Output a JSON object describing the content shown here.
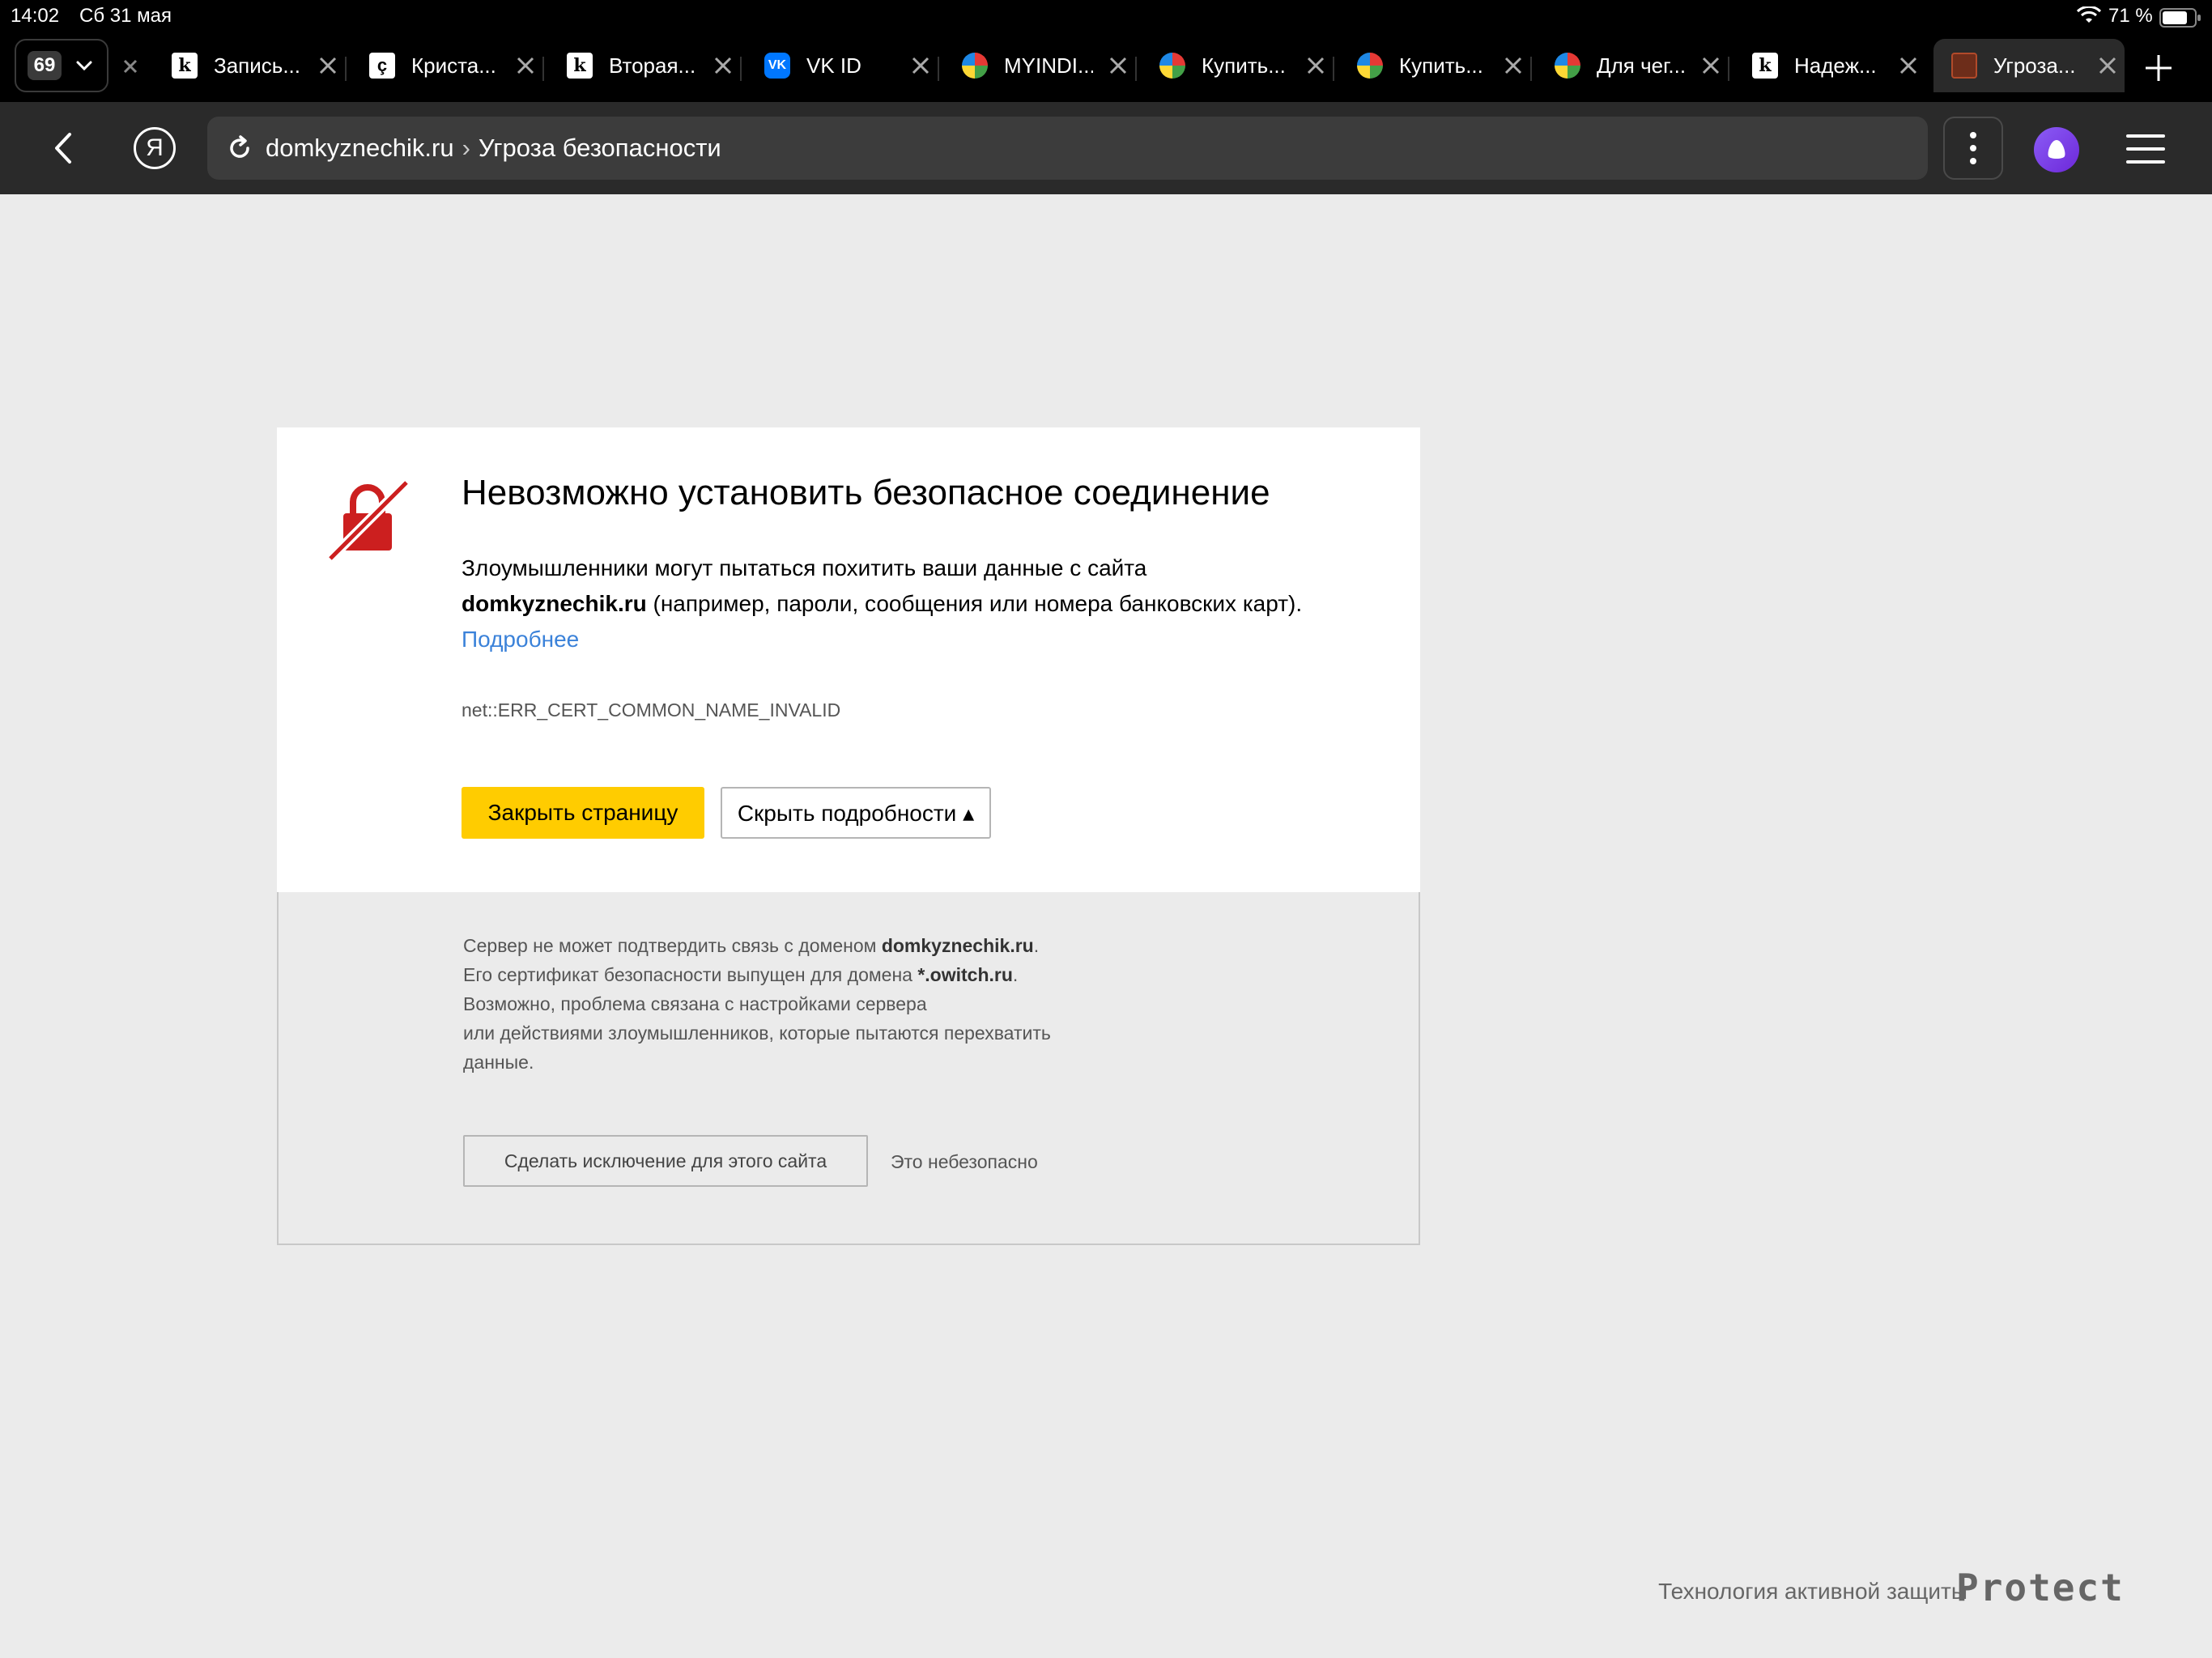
{
  "status_bar": {
    "time": "14:02",
    "date": "Сб 31 мая",
    "battery_percent": "71 %"
  },
  "tab_bar": {
    "tab_count": "69",
    "tabs": [
      {
        "label": "Запись...",
        "favicon": "k-icon"
      },
      {
        "label": "Криста...",
        "favicon": "c-icon"
      },
      {
        "label": "Вторая...",
        "favicon": "k-icon"
      },
      {
        "label": "VK ID",
        "favicon": "vk-icon",
        "favicon_text": "VK"
      },
      {
        "label": "MYINDI...",
        "favicon": "ball-icon"
      },
      {
        "label": "Купить...",
        "favicon": "ball-icon"
      },
      {
        "label": "Купить...",
        "favicon": "ball-icon"
      },
      {
        "label": "Для чег...",
        "favicon": "ball-icon"
      },
      {
        "label": "Надеж...",
        "favicon": "k-icon"
      },
      {
        "label": "Угроза...",
        "favicon": "red-icon",
        "active": true
      }
    ]
  },
  "toolbar": {
    "ya_letter": "Я",
    "url_host": "domkyznechik.ru",
    "url_separator": "›",
    "url_title": "Угроза безопасности"
  },
  "error": {
    "title": "Невозможно установить безопасное соединение",
    "desc_prefix": "Злоумышленники могут пытаться похитить ваши данные с сайта",
    "desc_domain": "domkyznechik.ru",
    "desc_suffix": " (например, пароли, сообщения или номера банковских карт).",
    "more_link": "Подробнее",
    "code": "net::ERR_CERT_COMMON_NAME_INVALID",
    "close_button": "Закрыть страницу",
    "hide_details_button": "Скрыть подробности ▴"
  },
  "details": {
    "line1_prefix": "Сервер не может подтвердить связь с доменом ",
    "line1_domain": "domkyznechik.ru",
    "line1_suffix": ".",
    "line2_prefix": "Его сертификат безопасности выпущен для домена ",
    "line2_domain": "*.owitch.ru",
    "line2_suffix": ".",
    "line3": "Возможно, проблема связана с настройками сервера",
    "line4": "или действиями злоумышленников, которые пытаются перехватить",
    "line5": "данные.",
    "exception_button": "Сделать исключение для этого сайта",
    "unsafe_label": "Это небезопасно"
  },
  "footer": {
    "text": "Технология активной защиты",
    "logo": "Protect"
  },
  "colors": {
    "accent_yellow": "#ffcc00",
    "danger_red": "#cc1f1f",
    "link_blue": "#3b82d9",
    "alice_purple": "#7c3aed"
  }
}
